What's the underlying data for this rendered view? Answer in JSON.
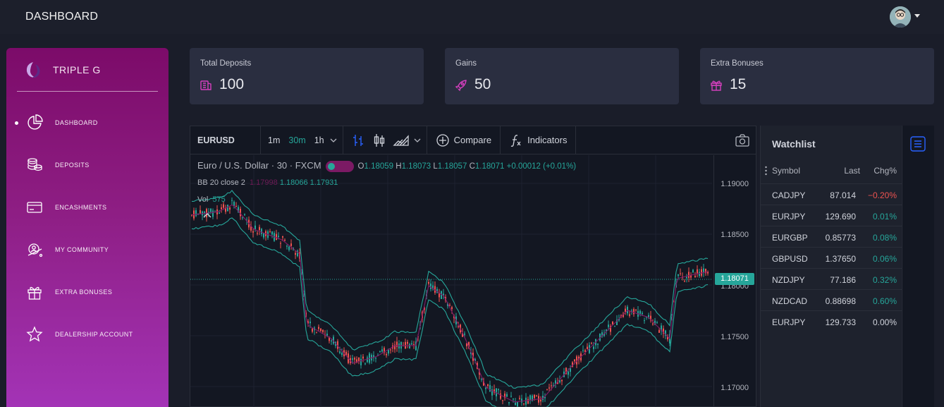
{
  "topbar": {
    "title": "DASHBOARD",
    "avatar_icon": "user-avatar-icon"
  },
  "sidebar": {
    "brand": "TRIPLE G",
    "items": [
      {
        "label": "DASHBOARD",
        "icon": "pie-chart-icon",
        "active": true
      },
      {
        "label": "DEPOSITS",
        "icon": "coins-stack-icon"
      },
      {
        "label": "ENCASHMENTS",
        "icon": "credit-card-icon"
      },
      {
        "label": "MY COMMUNITY",
        "icon": "community-globe-icon"
      },
      {
        "label": "EXTRA BONUSES",
        "icon": "gift-icon"
      },
      {
        "label": "DEALERSHIP ACCOUNT",
        "icon": "star-icon"
      }
    ],
    "gradient": [
      "#7c0b69",
      "#a434b8"
    ]
  },
  "cards": [
    {
      "label": "Total Deposits",
      "value": "100",
      "icon": "money-icon"
    },
    {
      "label": "Gains",
      "value": "50",
      "icon": "rocket-icon"
    },
    {
      "label": "Extra Bonuses",
      "value": "15",
      "icon": "gift-icon"
    }
  ],
  "chart": {
    "symbol": "EURUSD",
    "intervals": [
      "1m",
      "30m",
      "1h"
    ],
    "active_interval": "30m",
    "compare_label": "Compare",
    "indicators_label": "Indicators",
    "legend_title": "Euro / U.S. Dollar · 30 · FXCM",
    "ohlc": {
      "o": "1.18059",
      "h": "1.18073",
      "l": "1.18057",
      "c": "1.18071",
      "change": "+0.00012 (+0.01%)"
    },
    "bb_label": "BB 20 close 2",
    "bb_values": [
      "1.17998",
      "1.18066",
      "1.17931"
    ],
    "vol_label": "Vol",
    "vol_value": "575",
    "price_ticks": [
      "1.19000",
      "1.18500",
      "1.18000",
      "1.17500",
      "1.17000"
    ],
    "last_price": "1.18071",
    "colors": {
      "up": "#26a69a",
      "down": "#ef5350",
      "bands": "#26a69a",
      "basis": "#7b1a64"
    }
  },
  "watchlist": {
    "title": "Watchlist",
    "headers": {
      "symbol": "Symbol",
      "last": "Last",
      "chg": "Chg%"
    },
    "rows": [
      {
        "symbol": "CADJPY",
        "last": "87.014",
        "chg": "−0.20%",
        "dir": "neg"
      },
      {
        "symbol": "EURJPY",
        "last": "129.690",
        "chg": "0.01%",
        "dir": "pos"
      },
      {
        "symbol": "EURGBP",
        "last": "0.85773",
        "chg": "0.08%",
        "dir": "pos"
      },
      {
        "symbol": "GBPUSD",
        "last": "1.37650",
        "chg": "0.06%",
        "dir": "pos"
      },
      {
        "symbol": "NZDJPY",
        "last": "77.186",
        "chg": "0.32%",
        "dir": "pos"
      },
      {
        "symbol": "NZDCAD",
        "last": "0.88698",
        "chg": "0.60%",
        "dir": "pos"
      },
      {
        "symbol": "EURJPY",
        "last": "129.733",
        "chg": "0.00%",
        "dir": "neu"
      }
    ]
  }
}
